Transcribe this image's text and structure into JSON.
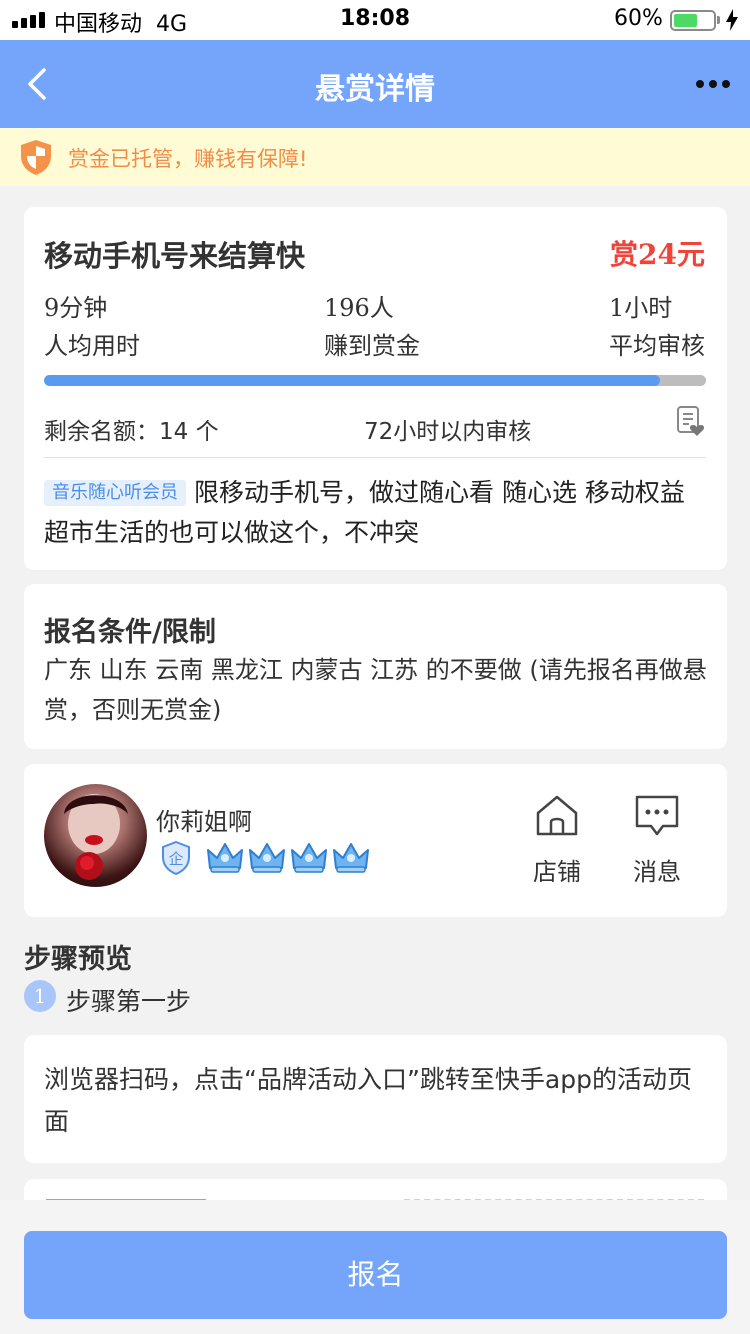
{
  "status_bar": {
    "carrier": "中国移动",
    "network": "4G",
    "time": "18:08",
    "battery_pct": "60%",
    "battery_level": 0.6
  },
  "nav": {
    "title": "悬赏详情",
    "back_icon": "chevron-left-icon",
    "more_icon": "more-dots-icon"
  },
  "notice": {
    "icon": "shield-icon",
    "text": "赏金已托管，赚钱有保障!"
  },
  "task": {
    "title": "移动手机号来结算快",
    "reward": "赏24元",
    "stats": [
      {
        "value": "9分钟",
        "label": "人均用时"
      },
      {
        "value": "196人",
        "label": "赚到赏金"
      },
      {
        "value": "1小时",
        "label": "平均审核"
      }
    ],
    "progress": 0.93,
    "remaining": "剩余名额：14 个",
    "audit": "72小时以内审核",
    "tag": "音乐随心听会员",
    "description": "限移动手机号，做过随心看 随心选 移动权益超市生活的也可以做这个，不冲突"
  },
  "conditions": {
    "title": "报名条件/限制",
    "body": "广东 山东 云南 黑龙江 内蒙古 江苏 的不要做 (请先报名再做悬赏，否则无赏金)"
  },
  "publisher": {
    "name": "你莉姐啊",
    "badge": "企",
    "crown_count": 4,
    "shop_label": "店铺",
    "message_label": "消息"
  },
  "steps": {
    "title": "步骤预览",
    "items": [
      {
        "number": "1",
        "label": "步骤第一步",
        "description": "浏览器扫码，点击“品牌活动入口”跳转至快手app的活动页面"
      }
    ]
  },
  "footer": {
    "signup_label": "报名"
  },
  "colors": {
    "primary": "#75a5fb",
    "reward": "#f0443a",
    "notice_text": "#f08d49",
    "notice_bg": "#fffbd5"
  }
}
